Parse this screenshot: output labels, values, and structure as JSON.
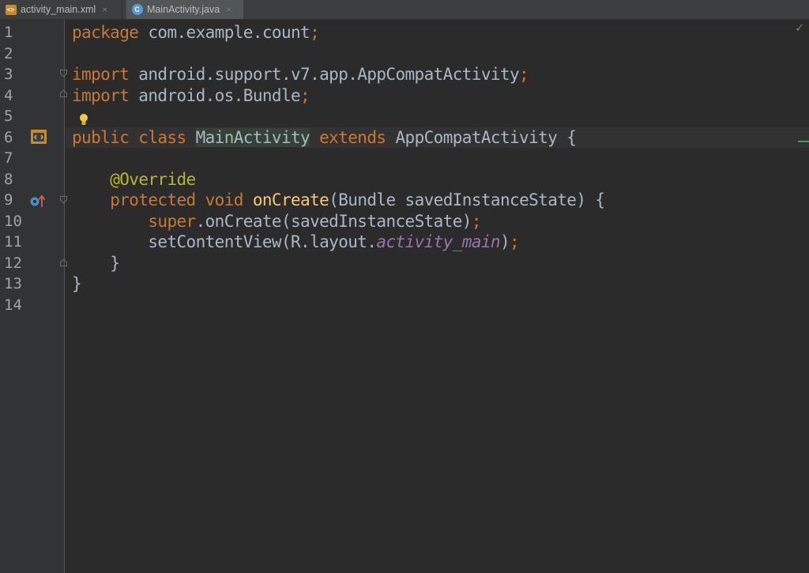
{
  "tabs": [
    {
      "label": "activity_main.xml",
      "icon": "xml-file-icon",
      "active": false
    },
    {
      "label": "MainActivity.java",
      "icon": "java-class-icon",
      "active": true
    }
  ],
  "close_glyph": "×",
  "line_numbers": [
    "1",
    "2",
    "3",
    "4",
    "5",
    "6",
    "7",
    "8",
    "9",
    "10",
    "11",
    "12",
    "13",
    "14"
  ],
  "code": {
    "l1": {
      "kw": "package",
      "rest": " com.example.count",
      "semi": ";"
    },
    "l3": {
      "kw": "import",
      "rest": " android.support.v7.app.AppCompatActivity",
      "semi": ";"
    },
    "l4": {
      "kw": "import",
      "rest": " android.os.Bundle",
      "semi": ";"
    },
    "l6": {
      "kw1": "public class ",
      "name": "MainActivity",
      "kw2": " extends ",
      "rest": "AppCompatActivity {"
    },
    "l8": {
      "indent": "    ",
      "ann": "@Override"
    },
    "l9": {
      "indent": "    ",
      "kw": "protected void ",
      "fn": "onCreate",
      "rest": "(Bundle savedInstanceState) {"
    },
    "l10": {
      "indent": "        ",
      "kw": "super",
      "rest": ".onCreate(savedInstanceState)",
      "semi": ";"
    },
    "l11": {
      "indent": "        ",
      "pre": "setContentView(R.layout.",
      "field": "activity_main",
      "post": ")",
      "semi": ";"
    },
    "l12": {
      "indent": "    ",
      "rest": "}"
    },
    "l13": {
      "rest": "}"
    }
  },
  "status": {
    "inspection": "✓"
  },
  "colors": {
    "keyword": "#cc7832",
    "annotation": "#bbb529",
    "method": "#ffc66d",
    "field": "#9876aa",
    "text": "#a9b7c6",
    "background": "#2b2b2b"
  }
}
